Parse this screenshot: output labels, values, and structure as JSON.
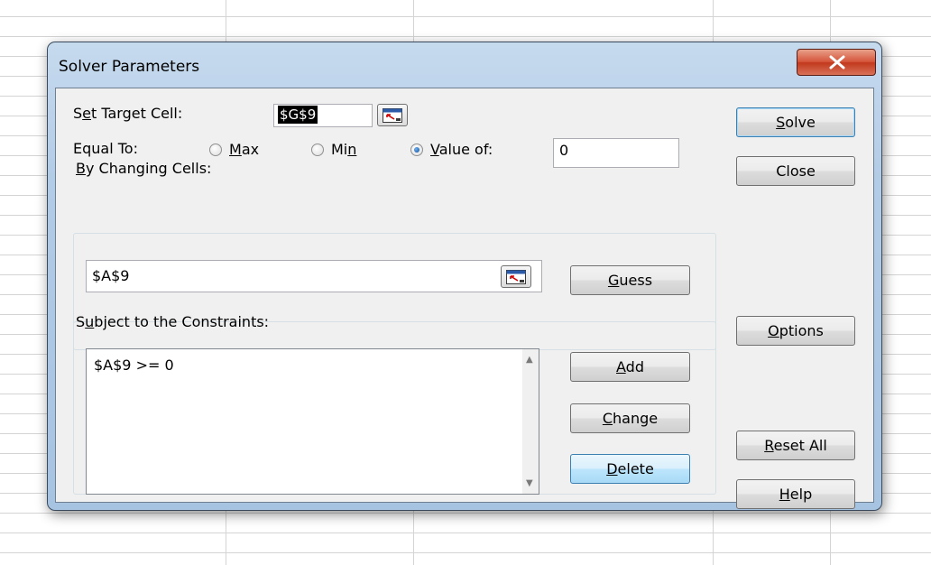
{
  "window": {
    "title": "Solver Parameters"
  },
  "target_cell": {
    "label_pre": "S",
    "label_key": "e",
    "label_post": "t Target Cell:",
    "value": "$G$9"
  },
  "equal_to": {
    "label": "Equal To:",
    "options": [
      {
        "pre": "",
        "key": "M",
        "post": "ax",
        "checked": false
      },
      {
        "pre": "Mi",
        "key": "n",
        "post": "",
        "checked": false
      },
      {
        "pre": "",
        "key": "V",
        "post": "alue of:",
        "checked": true
      }
    ],
    "value_of": "0"
  },
  "changing_cells": {
    "label_pre": "",
    "label_key": "B",
    "label_post": "y Changing Cells:",
    "value": "$A$9"
  },
  "constraints": {
    "label_pre": "S",
    "label_key": "u",
    "label_post": "bject to the Constraints:",
    "items": [
      "$A$9 >= 0"
    ]
  },
  "buttons": {
    "guess": {
      "pre": "",
      "key": "G",
      "post": "uess"
    },
    "add": {
      "pre": "",
      "key": "A",
      "post": "dd"
    },
    "change": {
      "pre": "",
      "key": "C",
      "post": "hange"
    },
    "delete": {
      "pre": "",
      "key": "D",
      "post": "elete"
    },
    "solve": {
      "pre": "",
      "key": "S",
      "post": "olve"
    },
    "close": {
      "pre": "",
      "key": "",
      "post": "Close"
    },
    "options": {
      "pre": "",
      "key": "O",
      "post": "ptions"
    },
    "reset_all": {
      "pre": "",
      "key": "R",
      "post": "eset All"
    },
    "help": {
      "pre": "",
      "key": "H",
      "post": "elp"
    }
  },
  "icons": {
    "close": "close-x-icon",
    "collapse_dialog": "collapse-dialog-icon",
    "scroll_up": "scroll-up-arrow-icon",
    "scroll_down": "scroll-down-arrow-icon"
  },
  "colors": {
    "window_frame": "#b2cbe6",
    "close_button": "#c2391d",
    "selection": "#000000",
    "focus_border": "#3c7fb1"
  }
}
